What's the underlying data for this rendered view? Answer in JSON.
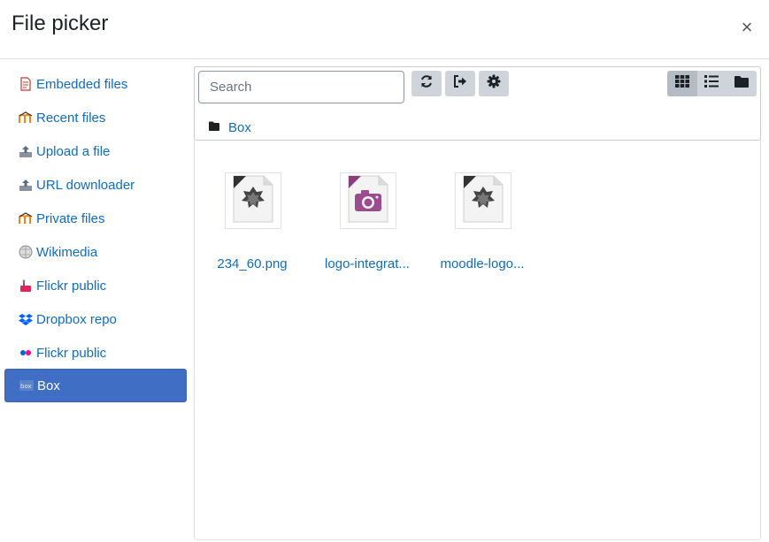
{
  "dialog": {
    "title": "File picker",
    "close_glyph": "×"
  },
  "sidebar": {
    "items": [
      {
        "label": "Embedded files",
        "icon": "embedded-files-icon"
      },
      {
        "label": "Recent files",
        "icon": "moodle-icon"
      },
      {
        "label": "Upload a file",
        "icon": "upload-icon"
      },
      {
        "label": "URL downloader",
        "icon": "url-downloader-icon"
      },
      {
        "label": "Private files",
        "icon": "moodle-icon"
      },
      {
        "label": "Wikimedia",
        "icon": "wikimedia-icon"
      },
      {
        "label": "Flickr public",
        "icon": "flickr-public-icon"
      },
      {
        "label": "Dropbox repo",
        "icon": "dropbox-icon"
      },
      {
        "label": "Flickr public",
        "icon": "flickr-icon"
      },
      {
        "label": "Box",
        "icon": "box-icon",
        "active": true
      }
    ]
  },
  "toolbar": {
    "search_placeholder": "Search",
    "buttons": [
      "refresh-icon",
      "logout-icon",
      "settings-icon"
    ],
    "views": [
      "grid-view-icon",
      "list-view-icon",
      "folder-view-icon"
    ]
  },
  "breadcrumb": {
    "label": "Box"
  },
  "files": [
    {
      "name": "234_60.png",
      "icon": "image-file-icon"
    },
    {
      "name": "logo-integrat...",
      "icon": "camera-file-icon"
    },
    {
      "name": "moodle-logo...",
      "icon": "image-file-icon"
    }
  ],
  "colors": {
    "link": "#0f6cbf",
    "active_bg": "#3f6ec4",
    "button_bg": "#ced4da"
  }
}
